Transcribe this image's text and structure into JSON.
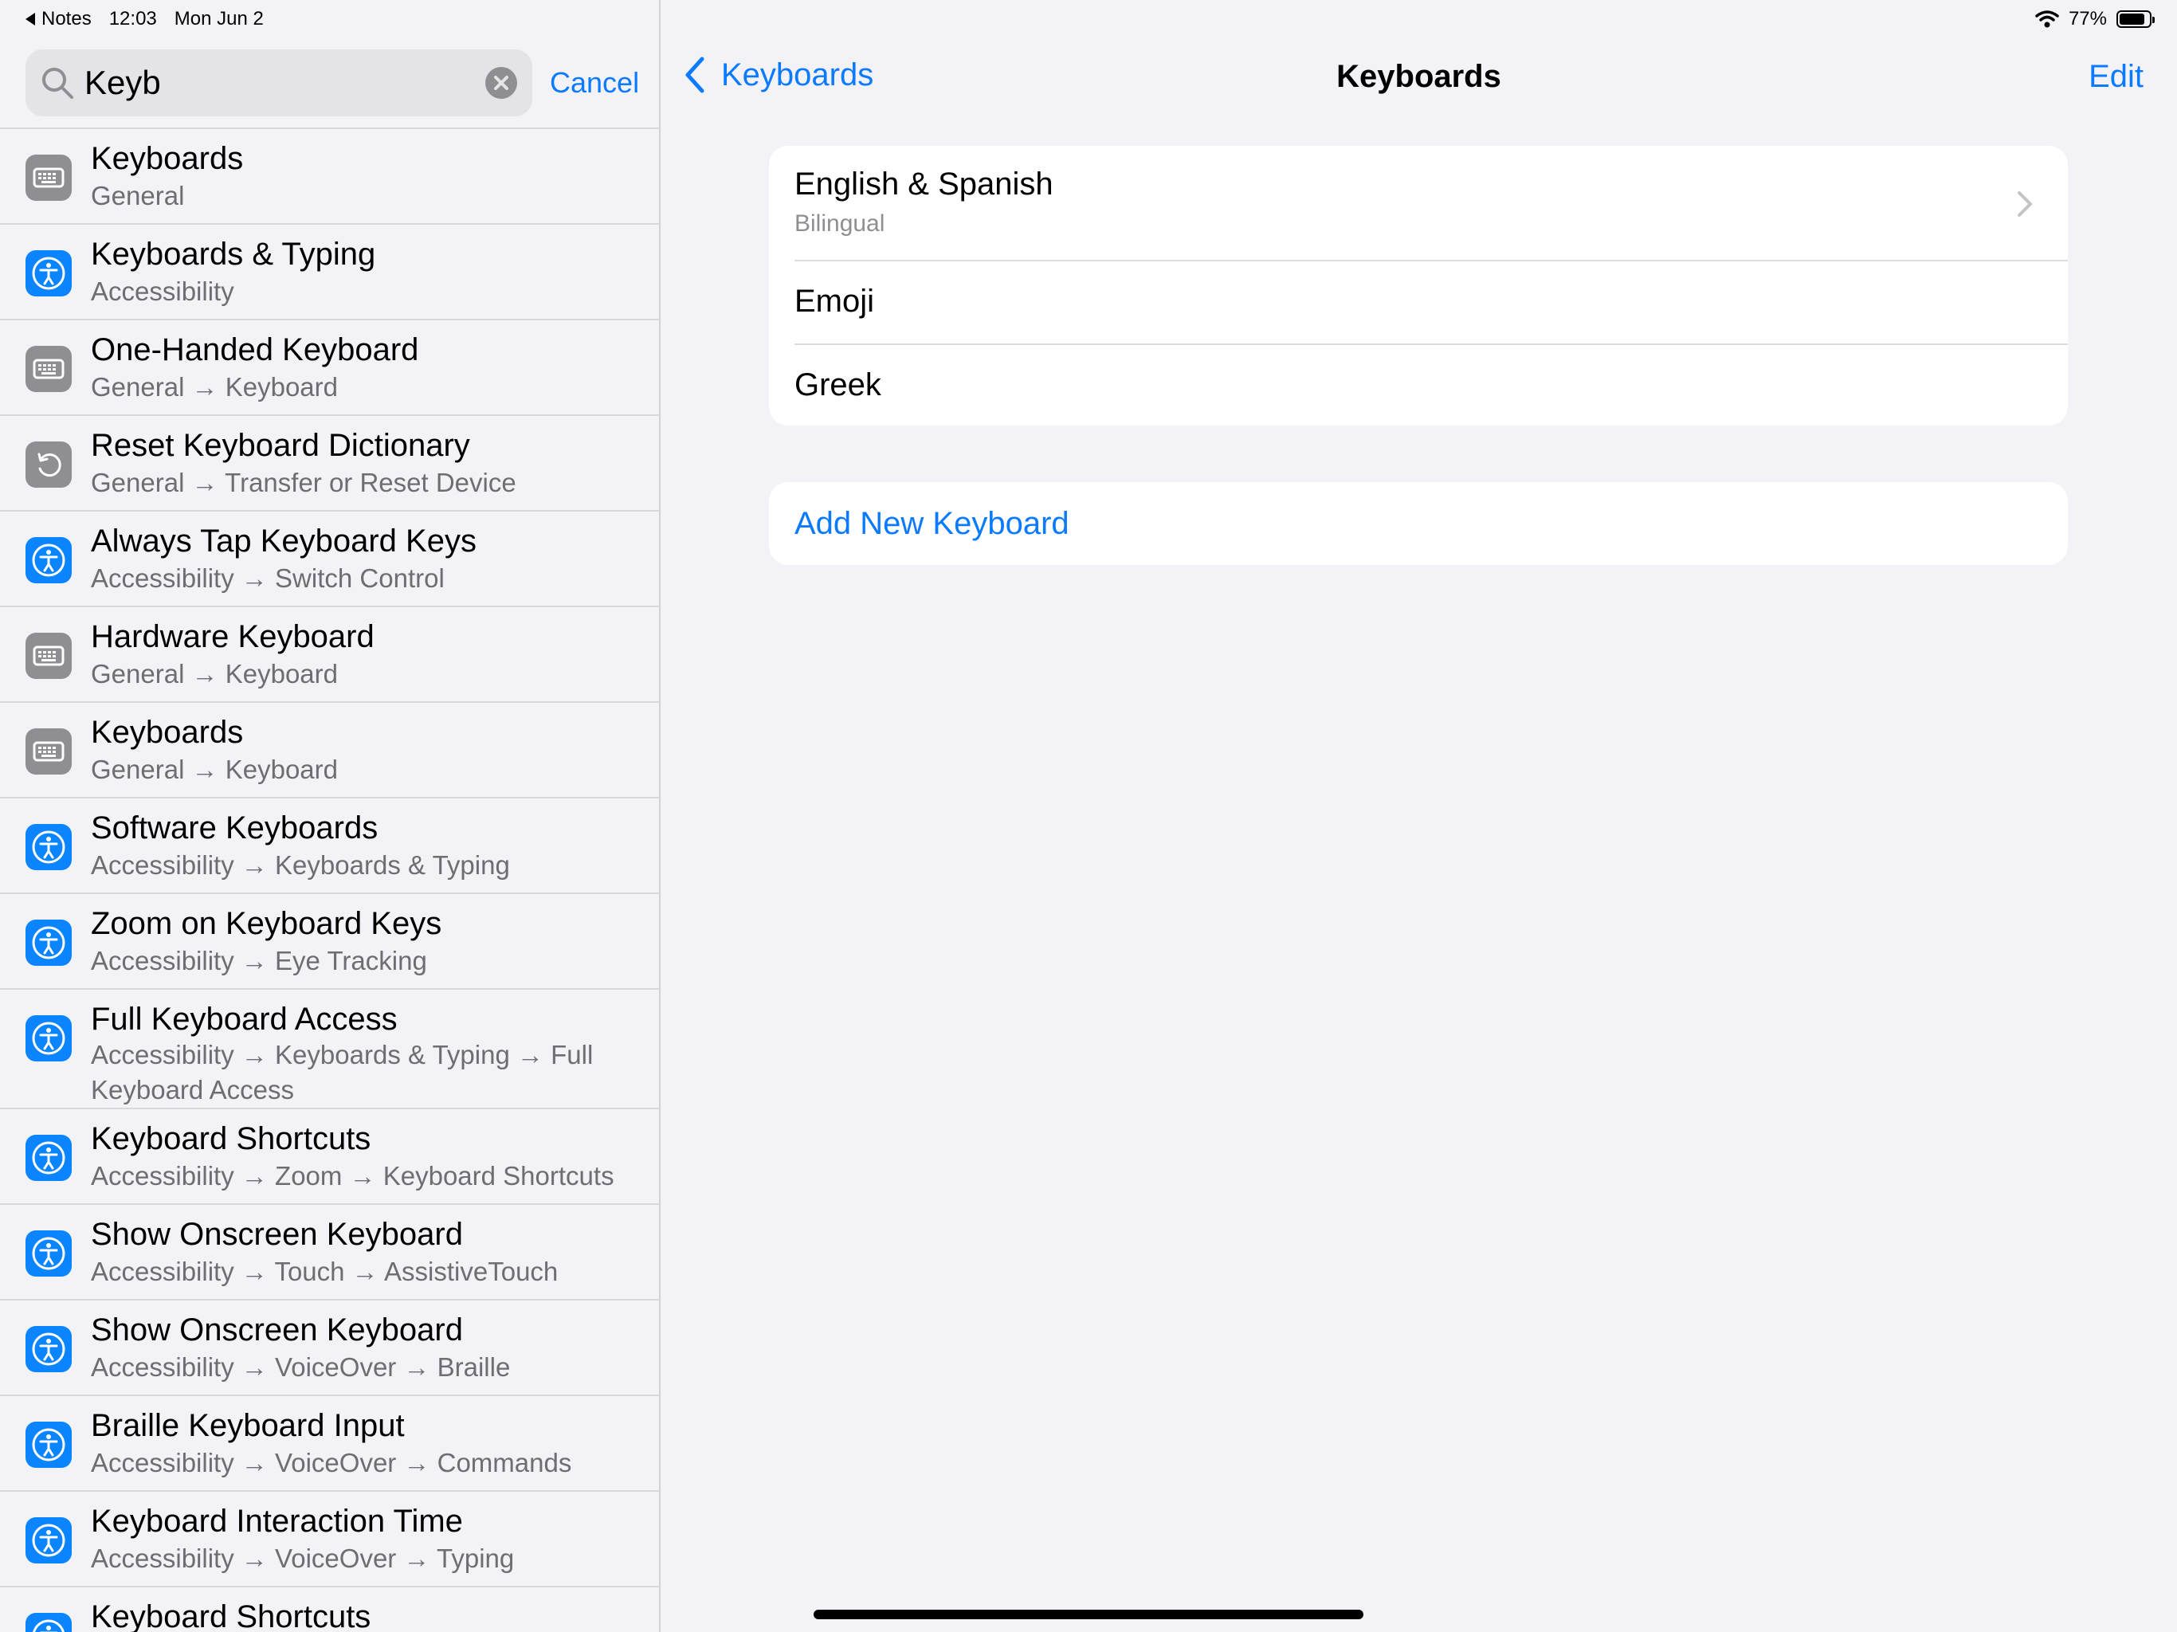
{
  "status_bar": {
    "back_app": "Notes",
    "time": "12:03",
    "date": "Mon Jun 2",
    "battery": "77%"
  },
  "search": {
    "query": "Keyb",
    "cancel_label": "Cancel"
  },
  "results": [
    {
      "title": "Keyboards",
      "path": "General",
      "icon": "keyboard-icon"
    },
    {
      "title": "Keyboards & Typing",
      "path": "Accessibility",
      "icon": "accessibility-icon"
    },
    {
      "title": "One-Handed Keyboard",
      "path": "General → Keyboard",
      "icon": "keyboard-icon"
    },
    {
      "title": "Reset Keyboard Dictionary",
      "path": "General → Transfer or Reset Device",
      "icon": "reset-icon"
    },
    {
      "title": "Always Tap Keyboard Keys",
      "path": "Accessibility → Switch Control",
      "icon": "accessibility-icon"
    },
    {
      "title": "Hardware Keyboard",
      "path": "General → Keyboard",
      "icon": "keyboard-icon"
    },
    {
      "title": "Keyboards",
      "path": "General → Keyboard",
      "icon": "keyboard-icon"
    },
    {
      "title": "Software Keyboards",
      "path": "Accessibility → Keyboards & Typing",
      "icon": "accessibility-icon"
    },
    {
      "title": "Zoom on Keyboard Keys",
      "path": "Accessibility → Eye Tracking",
      "icon": "accessibility-icon"
    },
    {
      "title": "Full Keyboard Access",
      "path": "Accessibility → Keyboards & Typing → Full Keyboard Access",
      "icon": "accessibility-icon"
    },
    {
      "title": "Keyboard Shortcuts",
      "path": "Accessibility → Zoom → Keyboard Shortcuts",
      "icon": "accessibility-icon"
    },
    {
      "title": "Show Onscreen Keyboard",
      "path": "Accessibility → Touch → AssistiveTouch",
      "icon": "accessibility-icon"
    },
    {
      "title": "Show Onscreen Keyboard",
      "path": "Accessibility → VoiceOver → Braille",
      "icon": "accessibility-icon"
    },
    {
      "title": "Braille Keyboard Input",
      "path": "Accessibility → VoiceOver → Commands",
      "icon": "accessibility-icon"
    },
    {
      "title": "Keyboard Interaction Time",
      "path": "Accessibility → VoiceOver → Typing",
      "icon": "accessibility-icon"
    },
    {
      "title": "Keyboard Shortcuts",
      "path": "",
      "icon": "accessibility-icon"
    }
  ],
  "detail": {
    "back_label": "Keyboards",
    "title": "Keyboards",
    "edit_label": "Edit",
    "keyboards": [
      {
        "name": "English & Spanish",
        "detail": "Bilingual"
      },
      {
        "name": "Emoji"
      },
      {
        "name": "Greek"
      }
    ],
    "add_label": "Add New Keyboard"
  },
  "colors": {
    "accent": "#0a7aff",
    "background": "#f2f2f7",
    "accessibility_icon": "#0a84ff",
    "settings_icon": "#8e8e93"
  }
}
